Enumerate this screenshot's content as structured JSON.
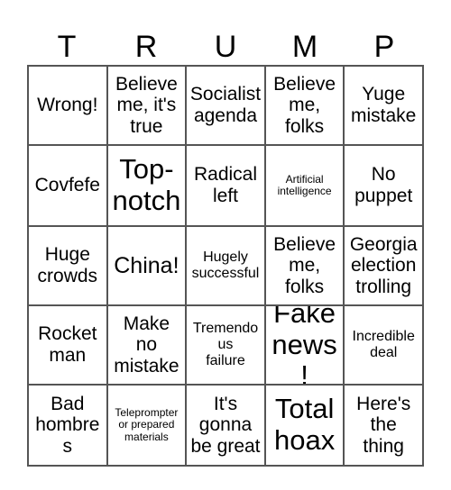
{
  "card": {
    "title_letters": [
      "T",
      "R",
      "U",
      "M",
      "P"
    ],
    "columns": 5,
    "rows": 5,
    "border_color": "#555555",
    "text_color": "#000000",
    "background_color": "#ffffff"
  },
  "cells": [
    {
      "text": "Wrong!",
      "size": "md"
    },
    {
      "text": "Believe\nme, it's\ntrue",
      "size": "md"
    },
    {
      "text": "Socialist\nagenda",
      "size": "md"
    },
    {
      "text": "Believe\nme,\nfolks",
      "size": "md"
    },
    {
      "text": "Yuge\nmistake",
      "size": "md"
    },
    {
      "text": "Covfefe",
      "size": "md"
    },
    {
      "text": "Top-\nnotch",
      "size": "xl"
    },
    {
      "text": "Radical\nleft",
      "size": "md"
    },
    {
      "text": "Artificial\nintelligence",
      "size": "xs"
    },
    {
      "text": "No\npuppet",
      "size": "md"
    },
    {
      "text": "Huge\ncrowds",
      "size": "md"
    },
    {
      "text": "China!",
      "size": "lg"
    },
    {
      "text": "Hugely\nsuccessful",
      "size": "sm"
    },
    {
      "text": "Believe\nme,\nfolks",
      "size": "md"
    },
    {
      "text": "Georgia\nelection\ntrolling",
      "size": "md"
    },
    {
      "text": "Rocket\nman",
      "size": "md"
    },
    {
      "text": "Make\nno\nmistake",
      "size": "md"
    },
    {
      "text": "Tremendous\nfailure",
      "size": "sm"
    },
    {
      "text": "Fake\nnews!",
      "size": "xl"
    },
    {
      "text": "Incredible\ndeal",
      "size": "sm"
    },
    {
      "text": "Bad\nhombres",
      "size": "md"
    },
    {
      "text": "Teleprompter\nor prepared\nmaterials",
      "size": "xs"
    },
    {
      "text": "It's\ngonna\nbe great",
      "size": "md"
    },
    {
      "text": "Total\nhoax",
      "size": "xl"
    },
    {
      "text": "Here's\nthe\nthing",
      "size": "md"
    }
  ]
}
